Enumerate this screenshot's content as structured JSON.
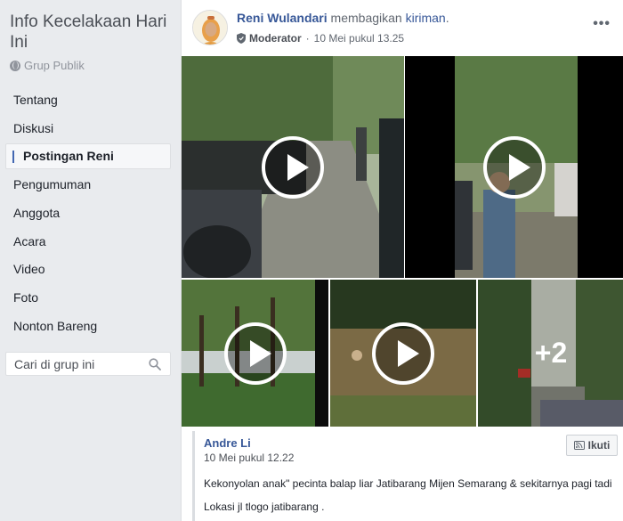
{
  "group": {
    "title": "Info Kecelakaan Hari Ini",
    "type": "Grup Publik"
  },
  "nav": {
    "items": [
      {
        "label": "Tentang"
      },
      {
        "label": "Diskusi"
      },
      {
        "label": "Postingan Reni"
      },
      {
        "label": "Pengumuman"
      },
      {
        "label": "Anggota"
      },
      {
        "label": "Acara"
      },
      {
        "label": "Video"
      },
      {
        "label": "Foto"
      },
      {
        "label": "Nonton Bareng"
      }
    ],
    "active_index": 2
  },
  "search": {
    "placeholder": "Cari di grup ini",
    "icon": "search-icon"
  },
  "post": {
    "author": "Reni Wulandari",
    "action_text": "membagikan",
    "object_link": "kiriman",
    "period": ".",
    "role_badge": "Moderator",
    "separator": "·",
    "timestamp": "10 Mei pukul 13.25",
    "more_count": "+2"
  },
  "shared_post": {
    "author": "Andre Li",
    "timestamp": "10 Mei pukul 12.22",
    "follow_label": "Ikuti",
    "text_line_1": "Kekonyolan anak\" pecinta balap liar Jatibarang Mijen Semarang & sekitarnya pagi tadi",
    "text_line_2": "Lokasi jl tlogo jatibarang ."
  },
  "colors": {
    "link": "#385898",
    "accent": "#4267b2",
    "background": "#e9ebee"
  }
}
